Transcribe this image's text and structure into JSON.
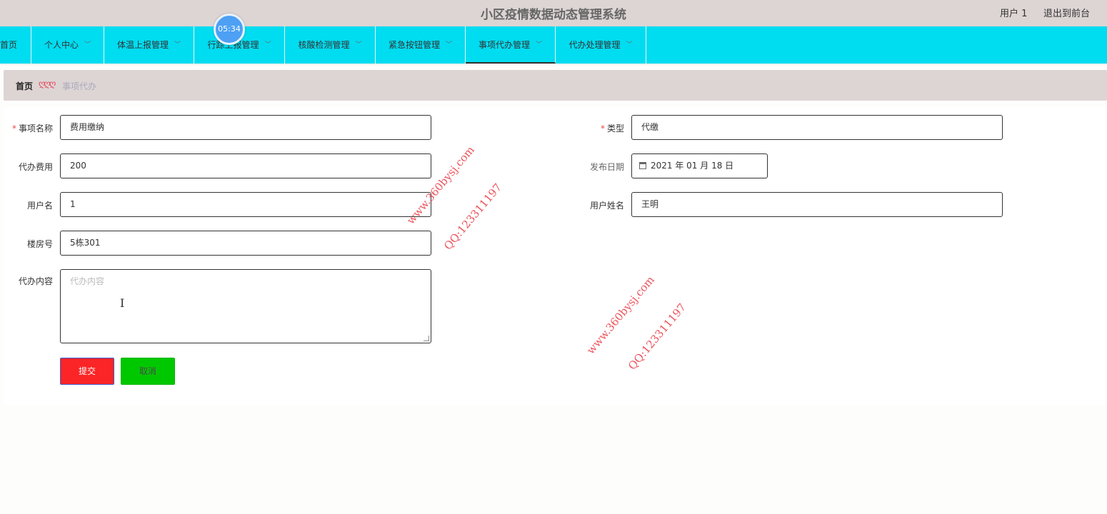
{
  "header": {
    "app_title": "小区疫情数据动态管理系统",
    "user_label": "用户 1",
    "exit_label": "退出到前台"
  },
  "timer": "05:34",
  "nav": {
    "items": [
      {
        "label": "首页",
        "has_dropdown": false
      },
      {
        "label": "个人中心",
        "has_dropdown": true
      },
      {
        "label": "体温上报管理",
        "has_dropdown": true
      },
      {
        "label": "行踪上报管理",
        "has_dropdown": true
      },
      {
        "label": "核酸检测管理",
        "has_dropdown": true
      },
      {
        "label": "紧急按钮管理",
        "has_dropdown": true
      },
      {
        "label": "事项代办管理",
        "has_dropdown": true,
        "active": true
      },
      {
        "label": "代办处理管理",
        "has_dropdown": true
      }
    ]
  },
  "breadcrumb": {
    "home": "首页",
    "separator": "ღღღ",
    "current": "事项代办"
  },
  "form": {
    "item_name": {
      "label": "事项名称",
      "required": true,
      "value": "费用缴纳"
    },
    "type": {
      "label": "类型",
      "required": true,
      "value": "代缴"
    },
    "fee": {
      "label": "代办费用",
      "value": "200"
    },
    "publish_date": {
      "label": "发布日期",
      "value": "2021 年 01 月 18 日"
    },
    "username": {
      "label": "用户名",
      "value": "1"
    },
    "user_realname": {
      "label": "用户姓名",
      "value": "王明"
    },
    "building": {
      "label": "楼房号",
      "value": "5栋301"
    },
    "content": {
      "label": "代办内容",
      "placeholder": "代办内容",
      "value": ""
    },
    "required_mark": "*",
    "submit_label": "提交",
    "cancel_label": "取消"
  },
  "watermarks": {
    "site": "www.360bysj.com",
    "qq": "QQ:123311197"
  },
  "colors": {
    "topbar": "#ddd5d4",
    "navbar": "#00dcf0",
    "submit": "#fb2426",
    "cancel": "#00c800",
    "watermark": "#e9353f"
  }
}
